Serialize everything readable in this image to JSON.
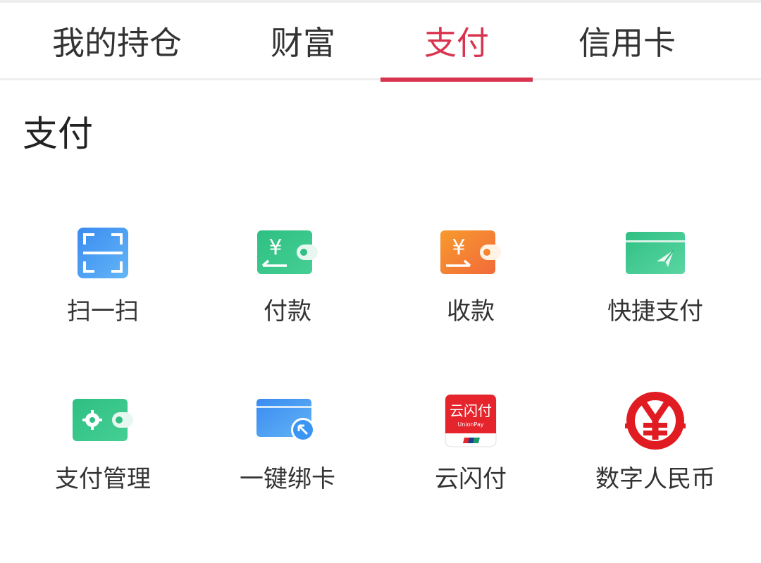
{
  "tabs": [
    {
      "label": "我的持仓",
      "active": false
    },
    {
      "label": "财富",
      "active": false
    },
    {
      "label": "支付",
      "active": true
    },
    {
      "label": "信用卡",
      "active": false
    }
  ],
  "accent_color": "#d9344f",
  "section": {
    "title": "支付"
  },
  "grid": {
    "items": [
      {
        "label": "扫一扫",
        "icon": "scan-icon"
      },
      {
        "label": "付款",
        "icon": "pay-wallet-icon"
      },
      {
        "label": "收款",
        "icon": "receive-wallet-icon"
      },
      {
        "label": "快捷支付",
        "icon": "quick-pay-card-icon"
      },
      {
        "label": "支付管理",
        "icon": "payment-settings-wallet-icon"
      },
      {
        "label": "一键绑卡",
        "icon": "bind-card-icon"
      },
      {
        "label": "云闪付",
        "icon": "unionpay-cloud-quickpass-icon",
        "icon_text": "云闪付",
        "icon_subtext": "UnionPay"
      },
      {
        "label": "数字人民币",
        "icon": "digital-rmb-icon"
      }
    ]
  }
}
